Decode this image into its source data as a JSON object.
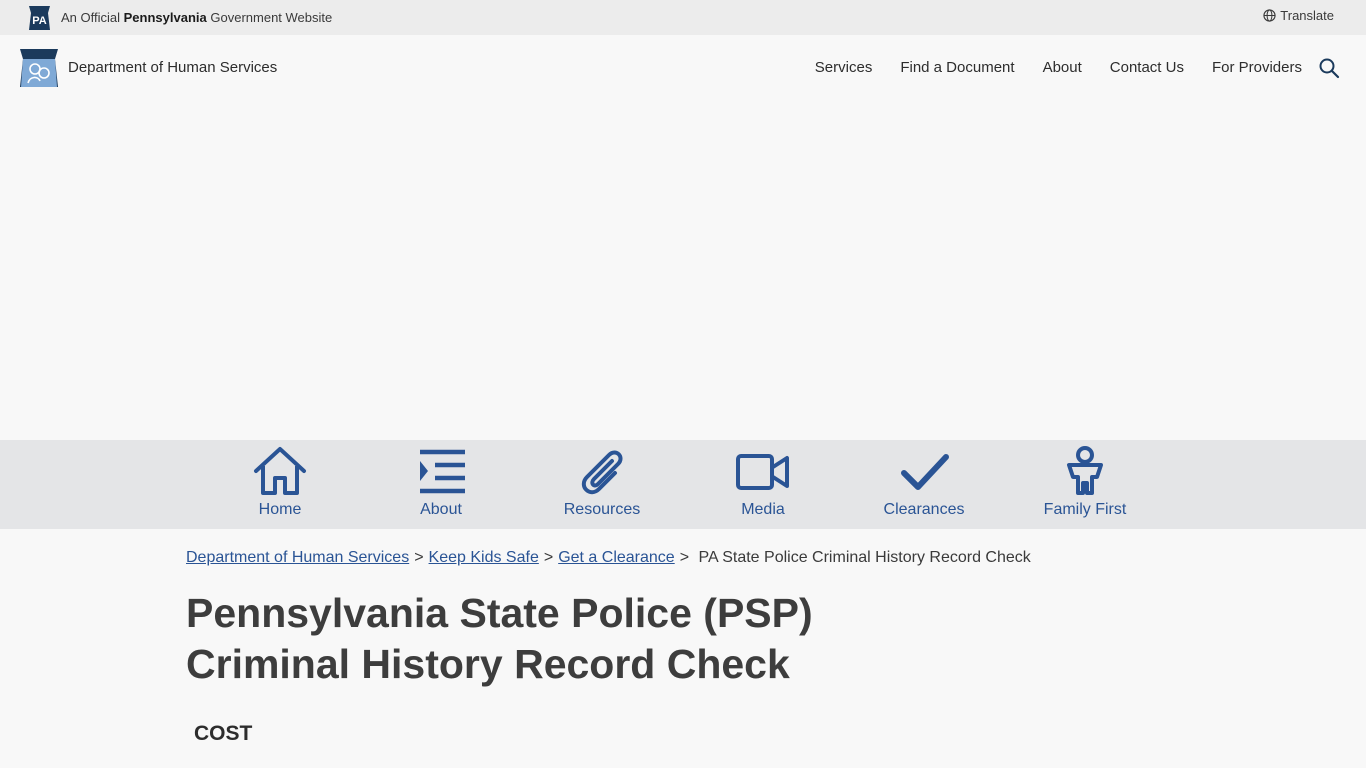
{
  "topbar": {
    "prefix": "An Official",
    "state": "Pennsylvania",
    "suffix": "Government Website",
    "badge_text": "PA",
    "translate_label": "Translate"
  },
  "header": {
    "site_name": "Department of Human Services",
    "nav": [
      "Services",
      "Find a Document",
      "About",
      "Contact Us",
      "For Providers"
    ]
  },
  "quicklinks": [
    {
      "label": "Home",
      "icon": "home-icon"
    },
    {
      "label": "About",
      "icon": "list-icon"
    },
    {
      "label": "Resources",
      "icon": "paperclip-icon"
    },
    {
      "label": "Media",
      "icon": "video-camera-icon"
    },
    {
      "label": "Clearances",
      "icon": "checkmark-icon"
    },
    {
      "label": "Family First",
      "icon": "person-icon"
    }
  ],
  "breadcrumb": {
    "links": [
      "Department of Human Services",
      "Keep Kids Safe",
      "Get a Clearance"
    ],
    "current": "PA State Police Criminal History Record Check"
  },
  "main": {
    "title_line1": "Pennsylvania State Police (PSP)",
    "title_line2": "Criminal History Record Check",
    "section_heading": "COST"
  },
  "colors": {
    "accent": "#2a5495",
    "topbar_bg": "#ececec",
    "iconbar_bg": "#e4e5e7",
    "badge": "#1b3a5c"
  }
}
